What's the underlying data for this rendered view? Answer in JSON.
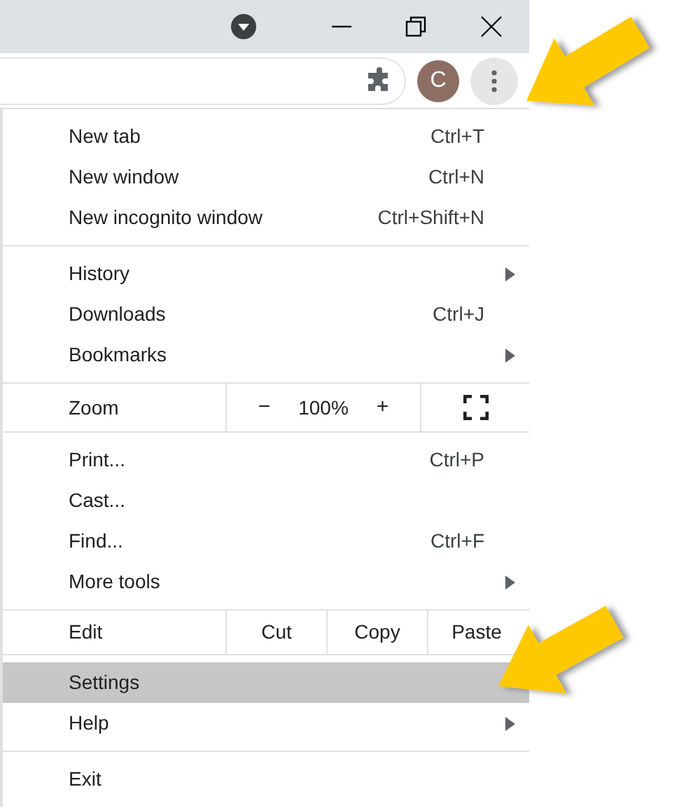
{
  "profile": {
    "initial": "C"
  },
  "menu": {
    "sections": [
      {
        "rows": [
          {
            "kind": "item",
            "label": "New tab",
            "shortcut": "Ctrl+T",
            "submenu": false,
            "selected": false
          },
          {
            "kind": "item",
            "label": "New window",
            "shortcut": "Ctrl+N",
            "submenu": false,
            "selected": false
          },
          {
            "kind": "item",
            "label": "New incognito window",
            "shortcut": "Ctrl+Shift+N",
            "submenu": false,
            "selected": false
          }
        ]
      },
      {
        "rows": [
          {
            "kind": "item",
            "label": "History",
            "submenu": true,
            "selected": false
          },
          {
            "kind": "item",
            "label": "Downloads",
            "shortcut": "Ctrl+J",
            "submenu": false,
            "selected": false
          },
          {
            "kind": "item",
            "label": "Bookmarks",
            "submenu": true,
            "selected": false
          }
        ]
      },
      {
        "rows": [
          {
            "kind": "zoom",
            "label": "Zoom",
            "minus": "−",
            "value": "100%",
            "plus": "+"
          }
        ]
      },
      {
        "rows": [
          {
            "kind": "item",
            "label": "Print...",
            "shortcut": "Ctrl+P",
            "submenu": false,
            "selected": false
          },
          {
            "kind": "item",
            "label": "Cast...",
            "submenu": false,
            "selected": false
          },
          {
            "kind": "item",
            "label": "Find...",
            "shortcut": "Ctrl+F",
            "submenu": false,
            "selected": false
          },
          {
            "kind": "item",
            "label": "More tools",
            "submenu": true,
            "selected": false
          }
        ]
      },
      {
        "rows": [
          {
            "kind": "edit",
            "label": "Edit",
            "actions": [
              "Cut",
              "Copy",
              "Paste"
            ]
          }
        ]
      },
      {
        "rows": [
          {
            "kind": "item",
            "label": "Settings",
            "submenu": false,
            "selected": true
          },
          {
            "kind": "item",
            "label": "Help",
            "submenu": true,
            "selected": false
          }
        ]
      },
      {
        "rows": [
          {
            "kind": "item",
            "label": "Exit",
            "submenu": false,
            "selected": false
          }
        ]
      }
    ]
  }
}
